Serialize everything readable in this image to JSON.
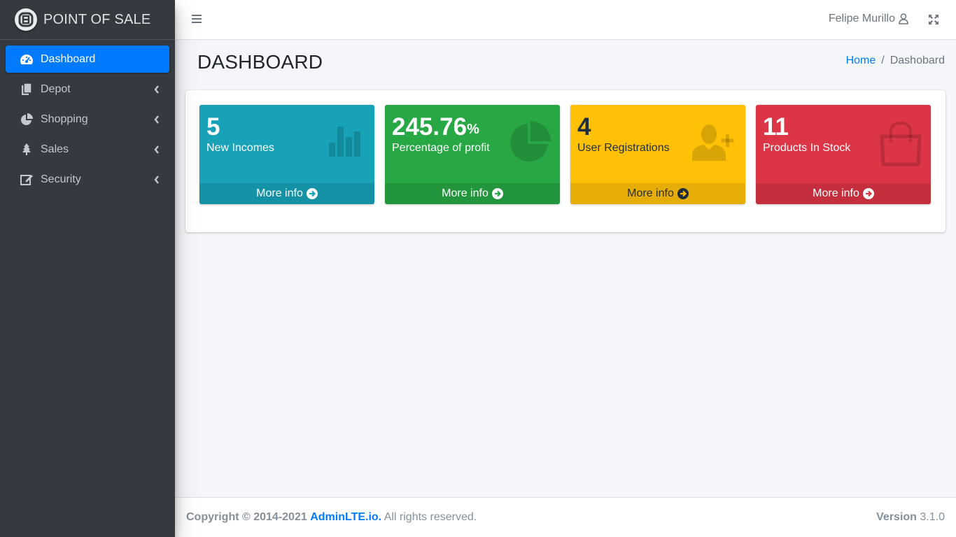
{
  "brand": {
    "name": "POINT OF SALE",
    "logo_icon": "brand-logo-icon"
  },
  "sidebar": {
    "items": [
      {
        "label": "Dashboard",
        "icon": "tachometer-icon",
        "active": true
      },
      {
        "label": "Depot",
        "icon": "copy-icon",
        "has_caret": true
      },
      {
        "label": "Shopping",
        "icon": "pie-chart-icon",
        "has_caret": true
      },
      {
        "label": "Sales",
        "icon": "tree-icon",
        "has_caret": true
      },
      {
        "label": "Security",
        "icon": "edit-icon",
        "has_caret": true
      }
    ]
  },
  "header": {
    "menu_icon": "hamburger-icon",
    "user_name": "Felipe Murillo",
    "user_icon": "user-icon",
    "fullscreen_icon": "expand-icon"
  },
  "page": {
    "title": "DASHBOARD",
    "breadcrumb": {
      "home": "Home",
      "separator": "/",
      "current": "Dashobard"
    }
  },
  "boxes": [
    {
      "value": "5",
      "suffix": "",
      "label": "New Incomes",
      "footer": "More info",
      "color": "#17a2b8",
      "icon": "bar-chart-icon"
    },
    {
      "value": "245.76",
      "suffix": "%",
      "label": "Percentage of profit",
      "footer": "More info",
      "color": "#28a745",
      "icon": "pie-chart-icon"
    },
    {
      "value": "4",
      "suffix": "",
      "label": "User Registrations",
      "footer": "More info",
      "color": "#ffc107",
      "icon": "user-plus-icon"
    },
    {
      "value": "11",
      "suffix": "",
      "label": "Products In Stock",
      "footer": "More info",
      "color": "#dc3545",
      "icon": "shopping-bag-icon"
    }
  ],
  "footer": {
    "copyright_prefix": "Copyright © 2014-2021",
    "link": "AdminLTE.io.",
    "rights": "All rights reserved.",
    "version_label": "Version",
    "version": "3.1.0"
  },
  "colors": {
    "primary": "#007bff",
    "sidebar_bg": "#343a40",
    "info": "#17a2b8",
    "success": "#28a745",
    "warning": "#ffc107",
    "danger": "#dc3545"
  }
}
